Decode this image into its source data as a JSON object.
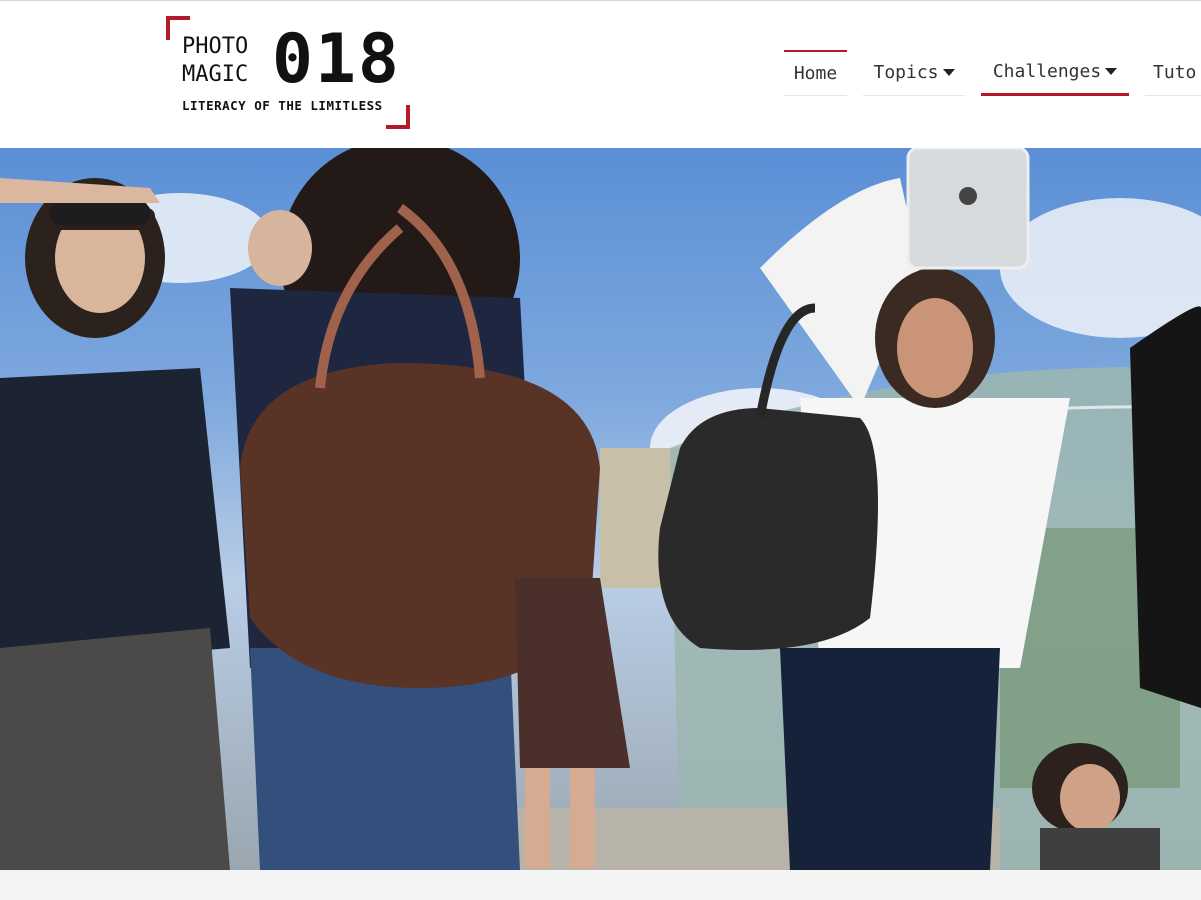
{
  "logo": {
    "line1": "PHOTO",
    "line2": "MAGIC",
    "number": "018",
    "tagline": "LITERACY OF THE LIMITLESS"
  },
  "nav": {
    "home": "Home",
    "topics": "Topics",
    "challenges": "Challenges",
    "tutorials": "Tuto"
  },
  "colors": {
    "accent": "#b3182b",
    "text": "#333333"
  },
  "icons": {
    "dropdown": "caret-down-icon"
  }
}
